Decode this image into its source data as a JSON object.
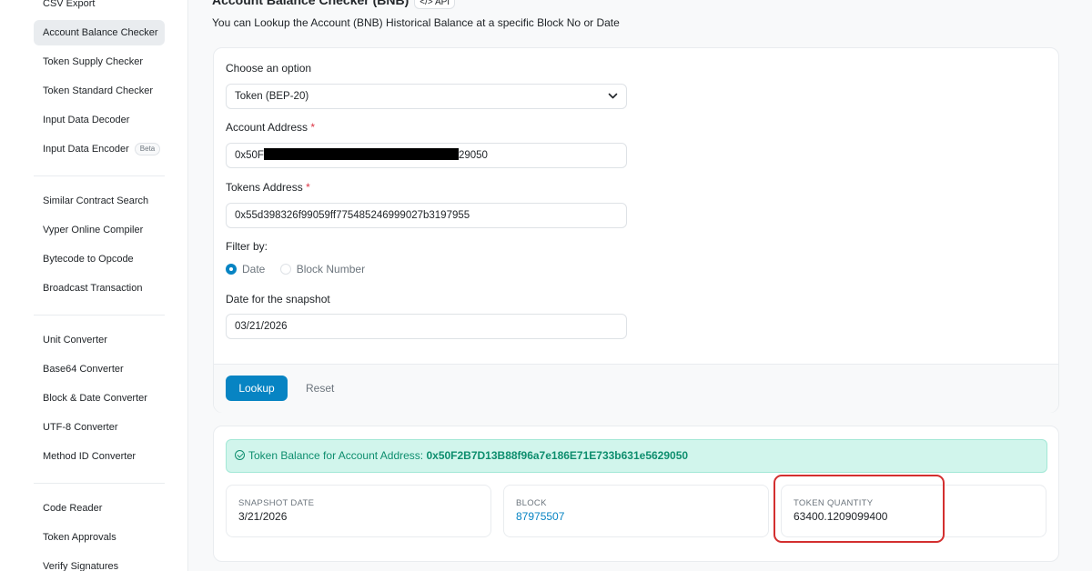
{
  "sidebar": {
    "items": [
      {
        "label": "CSV Export"
      },
      {
        "label": "Account Balance Checker"
      },
      {
        "label": "Token Supply Checker"
      },
      {
        "label": "Token Standard Checker"
      },
      {
        "label": "Input Data Decoder"
      },
      {
        "label": "Input Data Encoder",
        "badge": "Beta"
      },
      {
        "label": "Similar Contract Search"
      },
      {
        "label": "Vyper Online Compiler"
      },
      {
        "label": "Bytecode to Opcode"
      },
      {
        "label": "Broadcast Transaction"
      },
      {
        "label": "Unit Converter"
      },
      {
        "label": "Base64 Converter"
      },
      {
        "label": "Block & Date Converter"
      },
      {
        "label": "UTF-8 Converter"
      },
      {
        "label": "Method ID Converter"
      },
      {
        "label": "Code Reader"
      },
      {
        "label": "Token Approvals"
      },
      {
        "label": "Verify Signatures"
      }
    ],
    "active": "Account Balance Checker"
  },
  "header": {
    "title": "Account Balance Checker (BNB)",
    "api_badge": "</> API",
    "subtitle": "You can Lookup the Account (BNB) Historical Balance at a specific Block No or Date"
  },
  "form": {
    "option_label": "Choose an option",
    "option_value": "Token (BEP-20)",
    "account_label": "Account Address",
    "account_prefix": "0x50F",
    "account_suffix": "29050",
    "token_label": "Tokens Address",
    "token_value": "0x55d398326f99059ff775485246999027b3197955",
    "required_mark": "*",
    "filter_label": "Filter by:",
    "filter_date": "Date",
    "filter_block": "Block Number",
    "filter_selected": "Date",
    "snapshot_label": "Date for the snapshot",
    "snapshot_value": "03/21/2026",
    "lookup_button": "Lookup",
    "reset_button": "Reset"
  },
  "result": {
    "alert_prefix": "Token Balance for Account Address:",
    "alert_address": "0x50F2B7D13B88f96a7e186E71E733b631e5629050",
    "snapshot_date_label": "SNAPSHOT DATE",
    "snapshot_date_value": "3/21/2026",
    "block_label": "BLOCK",
    "block_value": "87975507",
    "quantity_label": "TOKEN QUANTITY",
    "quantity_value": "63400.1209099400"
  },
  "colors": {
    "primary": "#0784c3",
    "success_bg": "#d1f5ec",
    "success_text": "#0d8e6e",
    "highlight": "#d32f2f"
  }
}
